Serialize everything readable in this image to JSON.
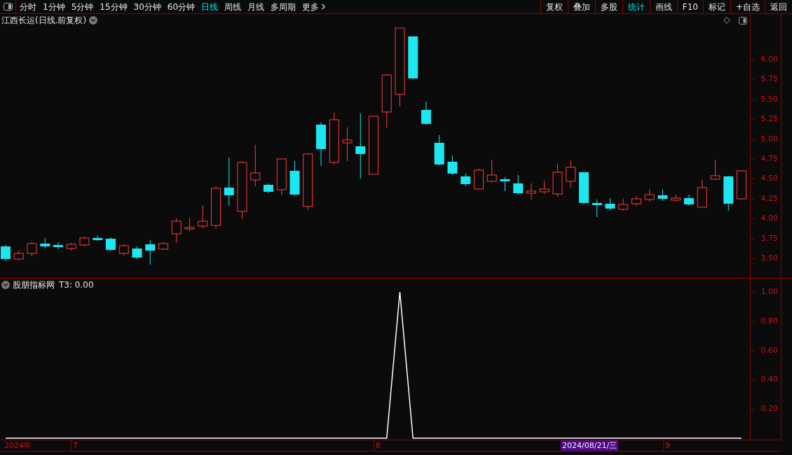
{
  "toolbar": {
    "periods": [
      {
        "label": "分时",
        "selected": false
      },
      {
        "label": "1分钟",
        "selected": false
      },
      {
        "label": "5分钟",
        "selected": false
      },
      {
        "label": "15分钟",
        "selected": false
      },
      {
        "label": "30分钟",
        "selected": false
      },
      {
        "label": "60分钟",
        "selected": false
      },
      {
        "label": "日线",
        "selected": true
      },
      {
        "label": "周线",
        "selected": false
      },
      {
        "label": "月线",
        "selected": false
      },
      {
        "label": "多周期",
        "selected": false
      },
      {
        "label": "更多",
        "selected": false
      }
    ],
    "actions": [
      {
        "label": "复权",
        "selected": false
      },
      {
        "label": "叠加",
        "selected": false
      },
      {
        "label": "多股",
        "selected": false
      },
      {
        "label": "统计",
        "selected": true
      },
      {
        "label": "画线",
        "selected": false
      },
      {
        "label": "F10",
        "selected": false
      },
      {
        "label": "标记",
        "selected": false
      },
      {
        "label": "+自选",
        "selected": false
      },
      {
        "label": "返回",
        "selected": false
      }
    ]
  },
  "main_chart": {
    "title": "江西长运(日线.前复权)",
    "price_ticks": [
      "6.00",
      "5.75",
      "5.50",
      "5.25",
      "5.00",
      "4.75",
      "4.50",
      "4.25",
      "4.00",
      "3.75",
      "3.50"
    ]
  },
  "indicator": {
    "name": "股朋指标网",
    "reading": "T3: 0.00",
    "chart_data": {
      "type": "line",
      "ylim": [
        0,
        1
      ],
      "yticks": [
        {
          "value": 1,
          "label": "1.00"
        },
        {
          "value": 0.8,
          "label": "0.80"
        },
        {
          "value": 0.6,
          "label": "0.60"
        },
        {
          "value": 0.4,
          "label": "0.40"
        },
        {
          "value": 0.2,
          "label": "0.20"
        }
      ],
      "series": [
        {
          "color": "#ffffff",
          "values": [
            0,
            0,
            0,
            0,
            0,
            0,
            0,
            0,
            0,
            0,
            0,
            0,
            0,
            0,
            0,
            0,
            0,
            0,
            0,
            0,
            0,
            0,
            0,
            0,
            0,
            0,
            0,
            0,
            0,
            0,
            1,
            0,
            0,
            0,
            0,
            0,
            0,
            0,
            0,
            0,
            0,
            0,
            0,
            0,
            0,
            0,
            0,
            0,
            0,
            0,
            0,
            0,
            0,
            0,
            0,
            0,
            0
          ]
        }
      ]
    }
  },
  "date_axis": [
    {
      "label": "2024年",
      "kind": "year"
    },
    {
      "label": "7",
      "kind": "month"
    },
    {
      "label": "8",
      "kind": "month"
    },
    {
      "label": "2024/08/21/三",
      "kind": "cursor"
    },
    {
      "label": "9",
      "kind": "month"
    }
  ]
}
